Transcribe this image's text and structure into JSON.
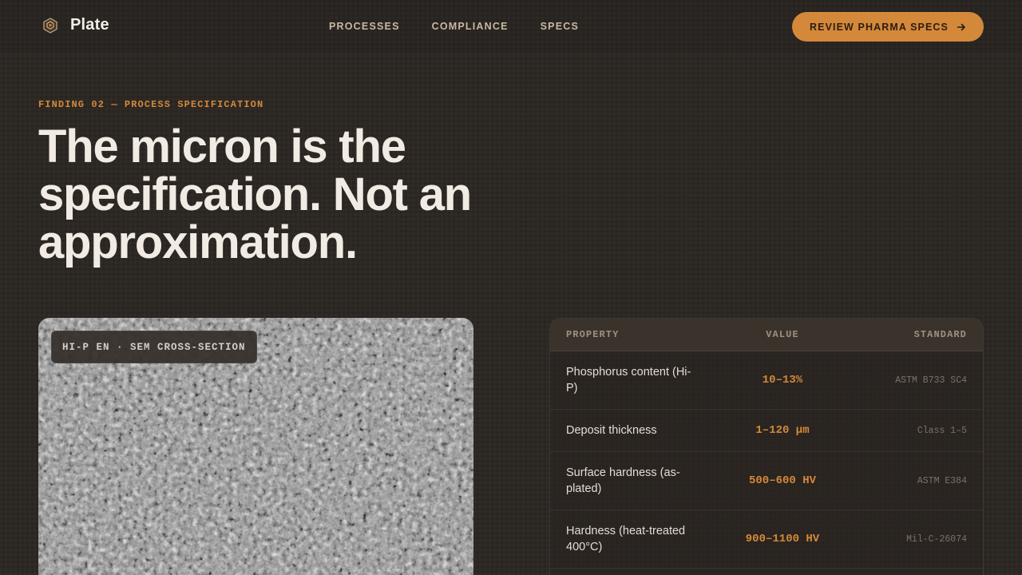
{
  "header": {
    "brand": "Plate",
    "logo_icon": "plate-logo-icon",
    "nav": [
      "PROCESSES",
      "COMPLIANCE",
      "SPECS"
    ],
    "cta_label": "REVIEW PHARMA SPECS",
    "cta_icon": "arrow-right-icon",
    "accent_color": "#d4883a"
  },
  "hero": {
    "eyebrow": "FINDING 02 — PROCESS SPECIFICATION",
    "headline": "The micron is the specification. Not an approximation."
  },
  "figure": {
    "tag": "HI-P EN · SEM CROSS-SECTION"
  },
  "specs": {
    "headers": {
      "property": "PROPERTY",
      "value": "VALUE",
      "standard": "STANDARD"
    },
    "rows": [
      {
        "property": "Phosphorus content (Hi-P)",
        "value": "10–13%",
        "standard": "ASTM B733 SC4"
      },
      {
        "property": "Deposit thickness",
        "value": "1–120 µm",
        "standard": "Class 1–5"
      },
      {
        "property": "Surface hardness (as-plated)",
        "value": "500–600 HV",
        "standard": "ASTM E384"
      },
      {
        "property": "Hardness (heat-treated 400°C)",
        "value": "900–1100 HV",
        "standard": "Mil-C-26074"
      }
    ]
  }
}
